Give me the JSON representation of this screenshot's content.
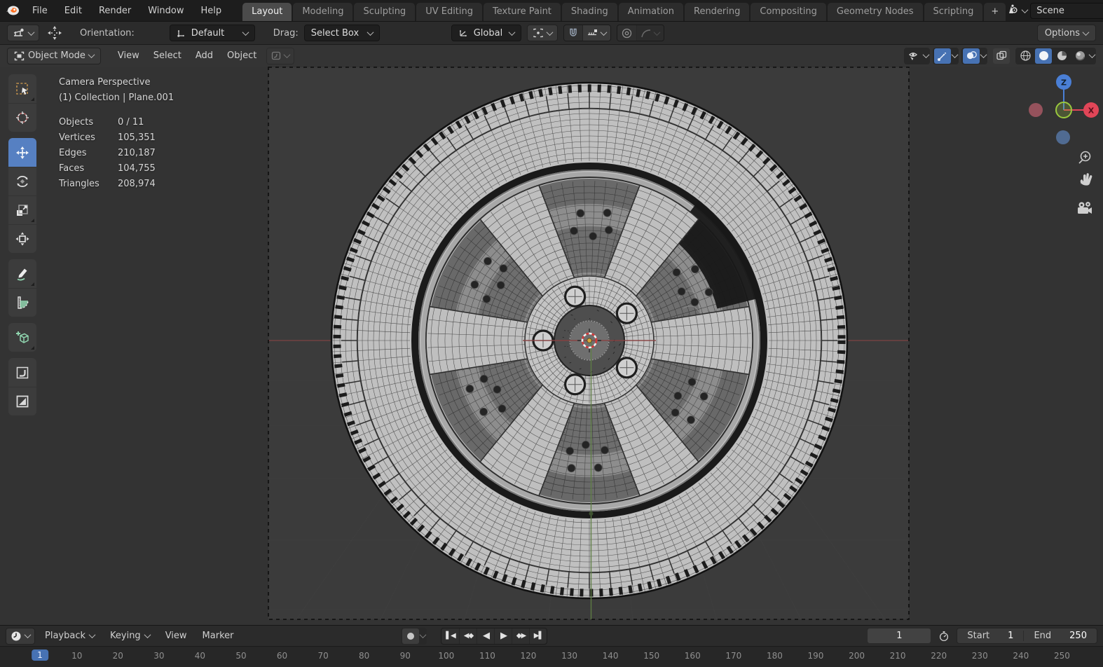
{
  "topbar": {
    "menus": [
      "File",
      "Edit",
      "Render",
      "Window",
      "Help"
    ],
    "tabs": [
      "Layout",
      "Modeling",
      "Sculpting",
      "UV Editing",
      "Texture Paint",
      "Shading",
      "Animation",
      "Rendering",
      "Compositing",
      "Geometry Nodes",
      "Scripting"
    ],
    "active_tab": "Layout",
    "add_tab": "+",
    "scene": "Scene"
  },
  "tool_settings": {
    "orientation_label": "Orientation:",
    "orientation_value": "Default",
    "drag_label": "Drag:",
    "drag_value": "Select Box",
    "transform_orientation": "Global",
    "options_label": "Options"
  },
  "viewport_header": {
    "mode": "Object Mode",
    "menus": [
      "View",
      "Select",
      "Add",
      "Object"
    ]
  },
  "tools": [
    {
      "name": "tweak-select-tool",
      "icon": "select-box",
      "sub": true
    },
    {
      "name": "cursor-tool",
      "icon": "cursor"
    },
    {
      "name": "move-tool",
      "icon": "move",
      "active": true
    },
    {
      "name": "rotate-tool",
      "icon": "rotate"
    },
    {
      "name": "scale-tool",
      "icon": "scale",
      "sub": true
    },
    {
      "name": "transform-tool",
      "icon": "transform"
    },
    {
      "name": "annotate-tool",
      "icon": "annotate",
      "sub": true
    },
    {
      "name": "measure-tool",
      "icon": "measure"
    },
    {
      "name": "add-cube-tool",
      "icon": "add-cube",
      "sub": true
    },
    {
      "name": "corner-curve-tool",
      "icon": "corner"
    },
    {
      "name": "triangle-square-tool",
      "icon": "tri-square"
    }
  ],
  "viewport": {
    "view_name": "Camera Perspective",
    "context": "(1) Collection | Plane.001",
    "stats": [
      {
        "label": "Objects",
        "value": "0 / 11"
      },
      {
        "label": "Vertices",
        "value": "105,351"
      },
      {
        "label": "Edges",
        "value": "210,187"
      },
      {
        "label": "Faces",
        "value": "104,755"
      },
      {
        "label": "Triangles",
        "value": "208,974"
      }
    ],
    "axis_labels": {
      "z": "Z",
      "x": "X"
    },
    "wheel": {
      "spokes": 6,
      "lug_holes": 5
    }
  },
  "timeline": {
    "playback_label": "Playback",
    "keying_label": "Keying",
    "view_label": "View",
    "marker_label": "Marker",
    "current_frame": "1",
    "start_label": "Start",
    "start_value": "1",
    "end_label": "End",
    "end_value": "250",
    "ruler_ticks": [
      1,
      10,
      20,
      30,
      40,
      50,
      60,
      70,
      80,
      90,
      100,
      110,
      120,
      130,
      140,
      150,
      160,
      170,
      180,
      190,
      200,
      210,
      220,
      230,
      240,
      250
    ]
  },
  "colors": {
    "accent_blue": "#4772b3",
    "axis_x_red": "#e14658",
    "axis_z_blue": "#4a7fd6",
    "axis_y_green": "#9ac83e",
    "logo_orange": "#ff7021"
  }
}
